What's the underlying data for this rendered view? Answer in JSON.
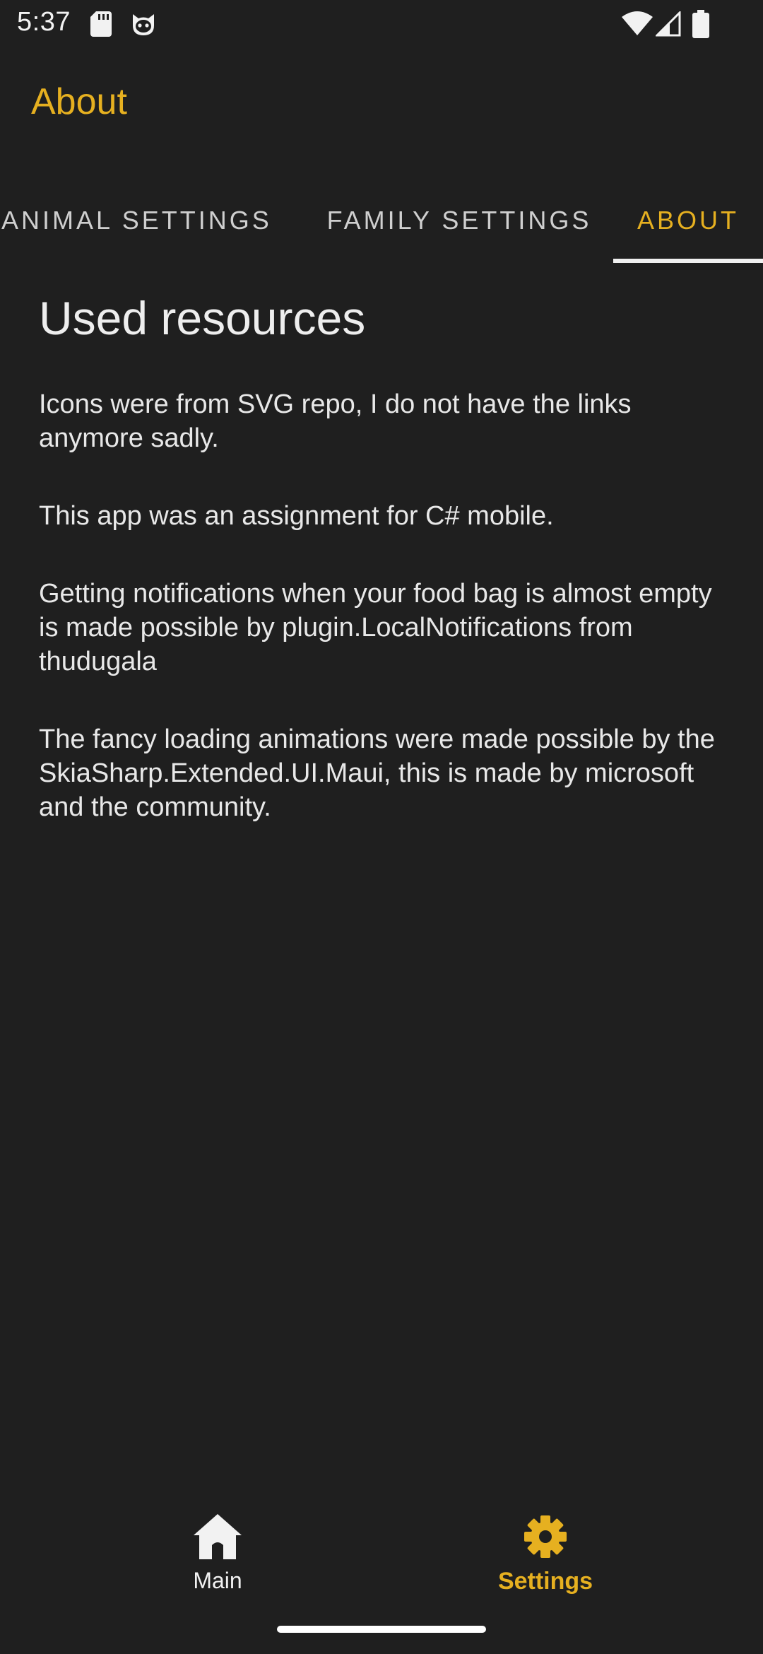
{
  "status_bar": {
    "time": "5:37",
    "icons": [
      "sd-card-icon",
      "cat-icon",
      "wifi-icon",
      "signal-icon",
      "battery-icon"
    ]
  },
  "app_bar": {
    "title": "About"
  },
  "tabs": [
    {
      "label": "ANIMAL SETTINGS",
      "selected": false
    },
    {
      "label": "FAMILY SETTINGS",
      "selected": false
    },
    {
      "label": "ABOUT",
      "selected": true
    }
  ],
  "content": {
    "heading": "Used resources",
    "paragraphs": [
      "Icons were from SVG repo, I do not have the links anymore sadly.",
      "This app was an assignment for C# mobile.",
      "Getting notifications when your food bag is almost empty is made possible by plugin.LocalNotifications from thudugala",
      "The fancy loading animations were made possible by the SkiaSharp.Extended.UI.Maui, this is made by microsoft and the community."
    ]
  },
  "bottom_nav": {
    "items": [
      {
        "label": "Main",
        "icon": "home-icon",
        "selected": false
      },
      {
        "label": "Settings",
        "icon": "gear-icon",
        "selected": true
      }
    ]
  },
  "colors": {
    "background": "#1f1f1f",
    "accent": "#e6b020",
    "text": "#e8e8e8",
    "tab_inactive": "#cfcfcf",
    "indicator": "#f0f0f0"
  }
}
